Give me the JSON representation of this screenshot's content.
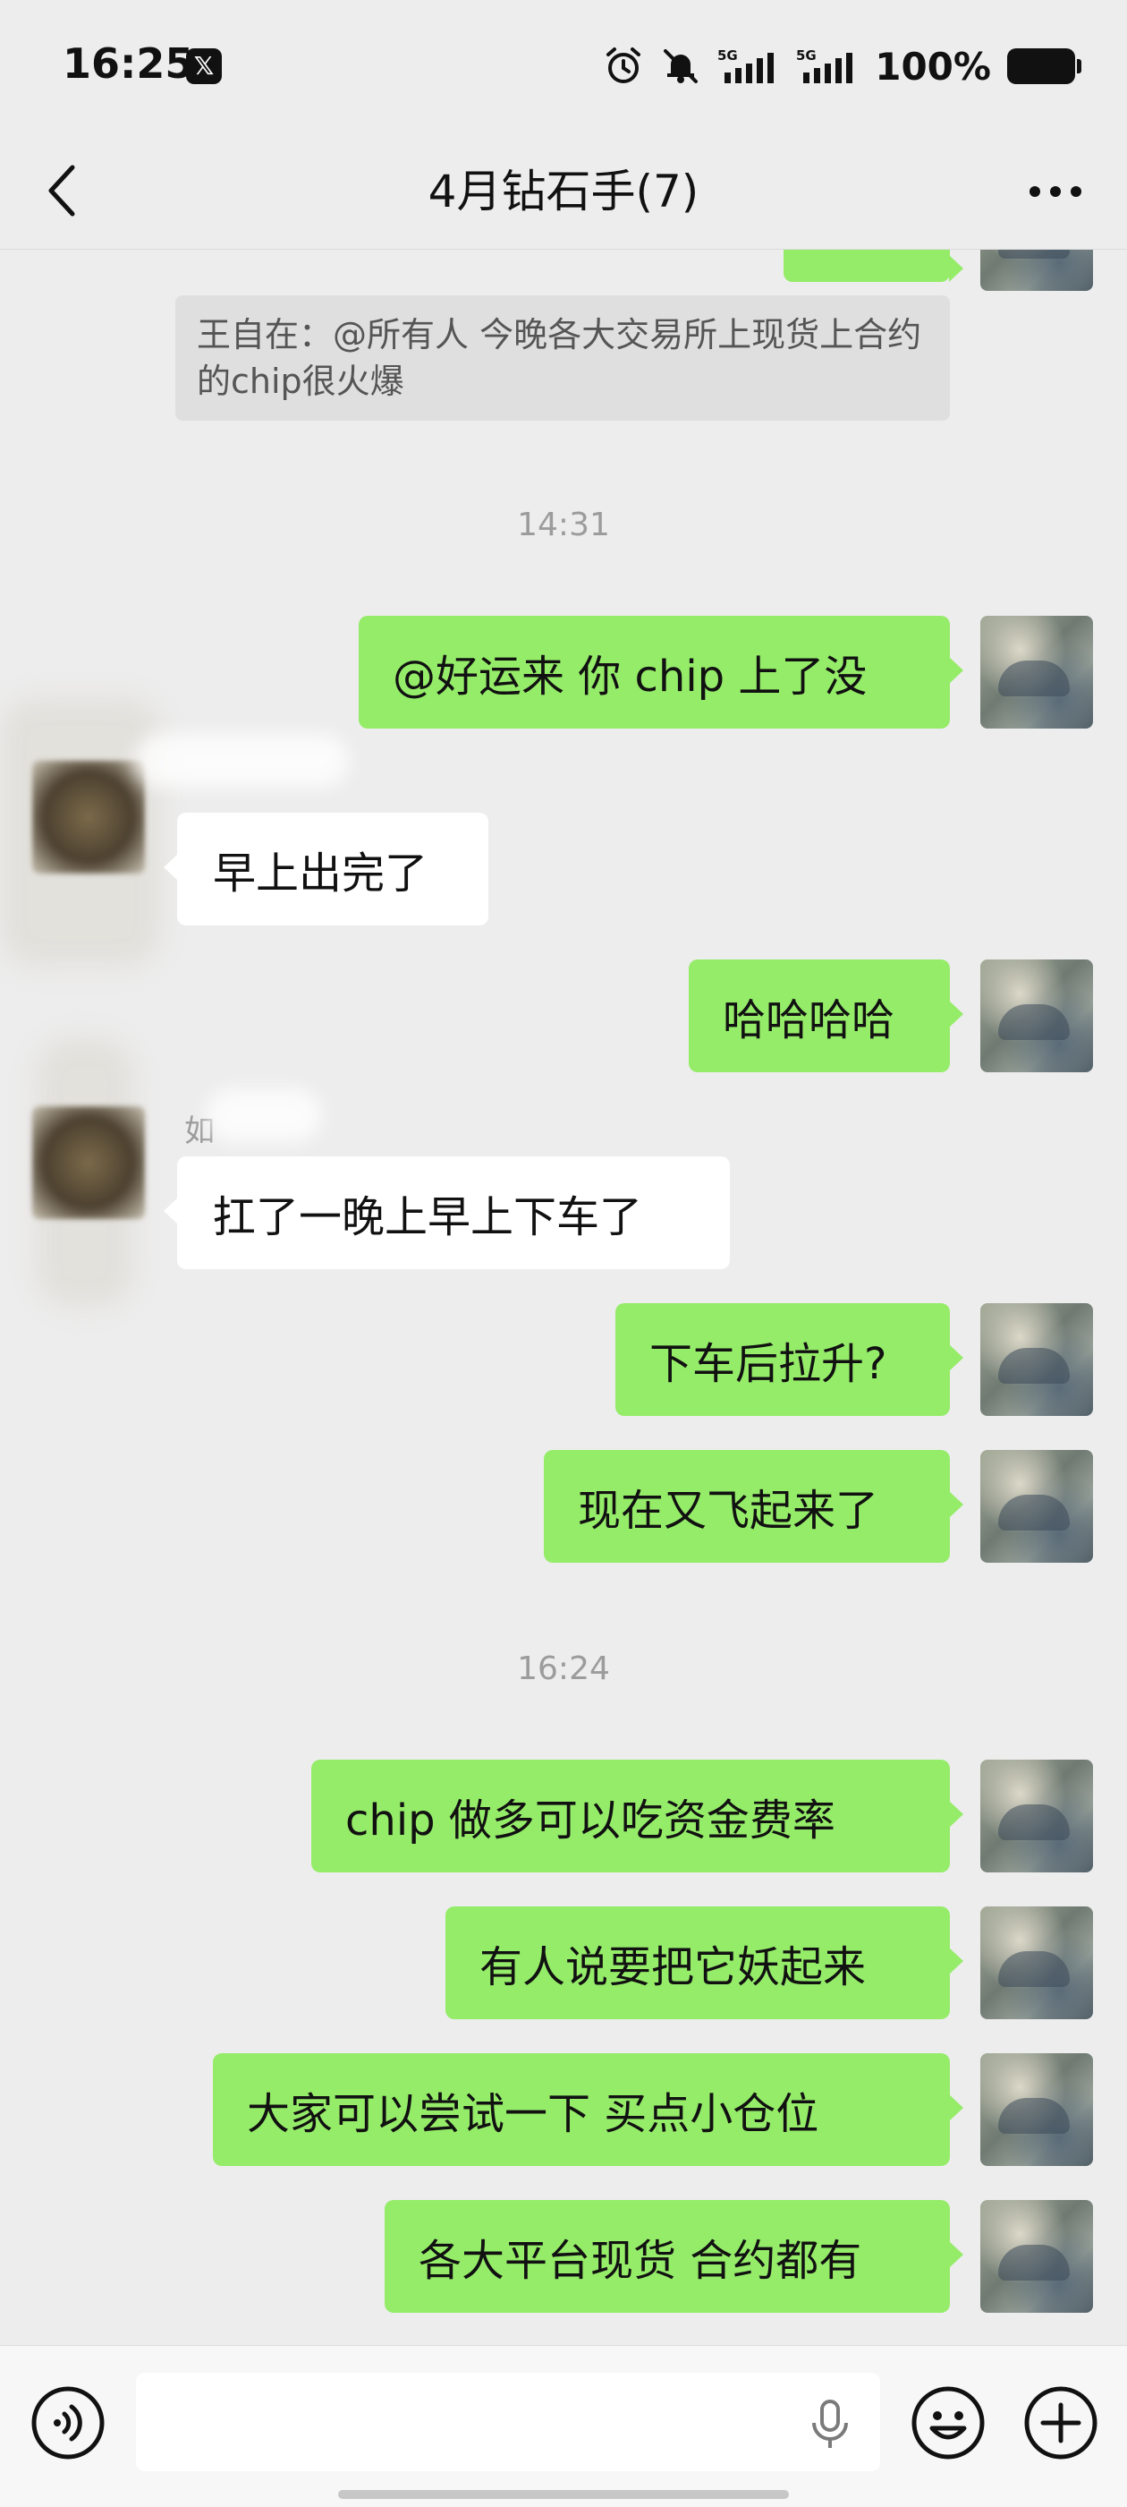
{
  "status_bar": {
    "time": "16:25",
    "app_icon": "x-logo",
    "network_1": "5G",
    "network_2": "5G",
    "battery": "100%",
    "icons": [
      "alarm-icon",
      "mute-icon",
      "signal-icon",
      "signal-icon",
      "battery-icon"
    ]
  },
  "nav": {
    "title": "4月钻石手(7)",
    "back_icon": "chevron-left-icon",
    "more_icon": "more-dots-icon"
  },
  "chat": {
    "quote_text": "王自在：@所有人 今晚各大交易所上现货上合约的chip很火爆",
    "time_1": "14:31",
    "msg_1": "@好运来  你 chip 上了没",
    "msg_2": "早上出完了",
    "msg_3": "哈哈哈哈",
    "sender_initial": "如",
    "msg_4": "扛了一晚上早上下车了",
    "msg_5": "下车后拉升?",
    "msg_6": "现在又飞起来了",
    "time_2": "16:24",
    "msg_7": "chip 做多可以吃资金费率",
    "msg_8": "有人说要把它妖起来",
    "msg_9": "大家可以尝试一下 买点小仓位",
    "msg_10": "各大平台现货 合约都有"
  },
  "input_bar": {
    "voice_icon": "voice-icon",
    "placeholder": "",
    "mic_icon": "mic-icon",
    "emoji_icon": "emoji-icon",
    "plus_icon": "plus-icon"
  },
  "colors": {
    "background": "#ededed",
    "outgoing_bubble": "#95ec69",
    "incoming_bubble": "#ffffff",
    "timestamp": "#9c9c9c"
  }
}
